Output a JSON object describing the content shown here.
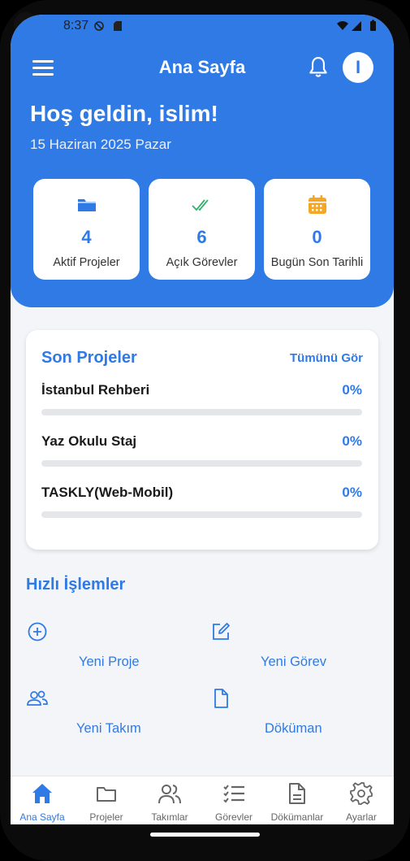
{
  "status": {
    "time": "8:37"
  },
  "header": {
    "title": "Ana Sayfa",
    "avatar_initial": "I",
    "greeting": "Hoş geldin, islim!",
    "date": "15 Haziran 2025 Pazar"
  },
  "stats": [
    {
      "icon": "folder-icon",
      "value": "4",
      "label": "Aktif Projeler"
    },
    {
      "icon": "double-check-icon",
      "value": "6",
      "label": "Açık Görevler"
    },
    {
      "icon": "calendar-icon",
      "value": "0",
      "label": "Bugün Son Tarihli"
    }
  ],
  "recent": {
    "title": "Son Projeler",
    "see_all": "Tümünü Gör",
    "projects": [
      {
        "name": "İstanbul Rehberi",
        "percent_label": "0%",
        "progress": 0
      },
      {
        "name": "Yaz Okulu Staj",
        "percent_label": "0%",
        "progress": 0
      },
      {
        "name": "TASKLY(Web-Mobil)",
        "percent_label": "0%",
        "progress": 0
      }
    ]
  },
  "quick": {
    "title": "Hızlı İşlemler",
    "actions": [
      {
        "icon": "plus-circle-icon",
        "label": "Yeni Proje"
      },
      {
        "icon": "edit-icon",
        "label": "Yeni Görev"
      },
      {
        "icon": "users-icon",
        "label": "Yeni Takım"
      },
      {
        "icon": "document-icon",
        "label": "Döküman"
      }
    ]
  },
  "nav": [
    {
      "icon": "home-icon",
      "label": "Ana Sayfa",
      "active": true
    },
    {
      "icon": "folder-icon",
      "label": "Projeler",
      "active": false
    },
    {
      "icon": "team-icon",
      "label": "Takımlar",
      "active": false
    },
    {
      "icon": "tasks-icon",
      "label": "Görevler",
      "active": false
    },
    {
      "icon": "file-icon",
      "label": "Dökümanlar",
      "active": false
    },
    {
      "icon": "settings-icon",
      "label": "Ayarlar",
      "active": false
    }
  ],
  "colors": {
    "primary": "#2f7ae5",
    "green": "#2fb36b",
    "orange": "#f5a623"
  }
}
